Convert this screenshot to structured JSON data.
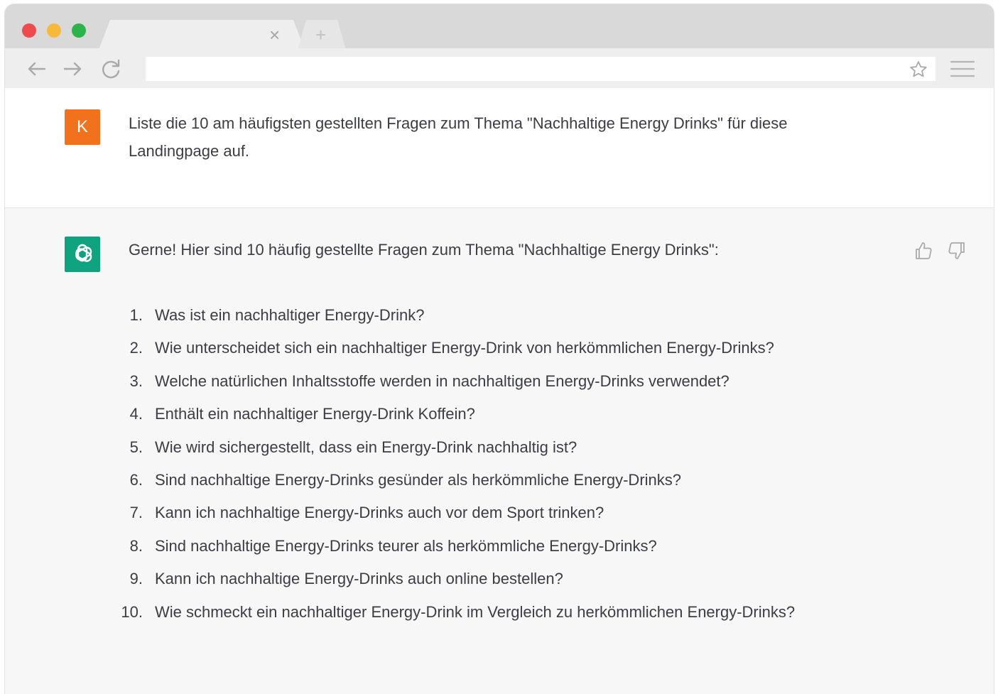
{
  "browser": {
    "tab_close_glyph": "×",
    "new_tab_glyph": "+",
    "icons": [
      "back-arrow-icon",
      "forward-arrow-icon",
      "reload-icon",
      "star-icon",
      "menu-icon"
    ]
  },
  "user_message": {
    "avatar_letter": "K",
    "avatar_color": "#f2711c",
    "text": "Liste die 10 am häufigsten gestellten Fragen zum Thema \"Nachhaltige Energy Drinks\" für diese Landingpage auf."
  },
  "assistant_message": {
    "avatar_color": "#10a37f",
    "intro": "Gerne! Hier sind 10 häufig gestellte Fragen zum Thema \"Nachhaltige Energy Drinks\":",
    "faqs": [
      {
        "num": "1.",
        "text": "Was ist ein nachhaltiger Energy-Drink?"
      },
      {
        "num": "2.",
        "text": "Wie unterscheidet sich ein nachhaltiger Energy-Drink von herkömmlichen Energy-Drinks?"
      },
      {
        "num": "3.",
        "text": "Welche natürlichen Inhaltsstoffe werden in nachhaltigen Energy-Drinks verwendet?"
      },
      {
        "num": "4.",
        "text": "Enthält ein nachhaltiger Energy-Drink Koffein?"
      },
      {
        "num": "5.",
        "text": "Wie wird sichergestellt, dass ein Energy-Drink nachhaltig ist?"
      },
      {
        "num": "6.",
        "text": "Sind nachhaltige Energy-Drinks gesünder als herkömmliche Energy-Drinks?"
      },
      {
        "num": "7.",
        "text": "Kann ich nachhaltige Energy-Drinks auch vor dem Sport trinken?"
      },
      {
        "num": "8.",
        "text": "Sind nachhaltige Energy-Drinks teurer als herkömmliche Energy-Drinks?"
      },
      {
        "num": "9.",
        "text": "Kann ich nachhaltige Energy-Drinks auch online bestellen?"
      },
      {
        "num": "10.",
        "text": "Wie schmeckt ein nachhaltiger Energy-Drink im Vergleich zu herkömmlichen Energy-Drinks?"
      }
    ]
  }
}
